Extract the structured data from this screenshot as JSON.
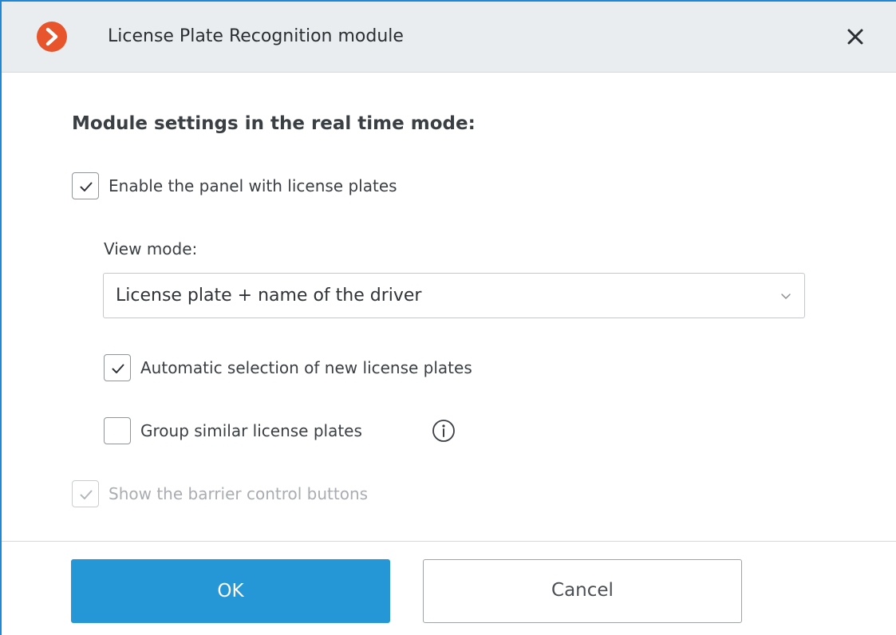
{
  "dialog": {
    "title": "License Plate Recognition module",
    "app_icon": "chevron-right-circle-icon",
    "close_icon": "close-icon",
    "accent_color": "#2596d6",
    "brand_color": "#e8542c"
  },
  "settings": {
    "heading": "Module settings in the real time mode:",
    "enable_panel": {
      "label": "Enable the panel with license plates",
      "checked": true
    },
    "view_mode": {
      "label": "View mode:",
      "selected": "License plate + name of the driver"
    },
    "auto_select": {
      "label": "Automatic selection of new license plates",
      "checked": true
    },
    "group_similar": {
      "label": "Group similar license plates",
      "checked": false,
      "info_icon": "info-icon"
    },
    "barrier_buttons": {
      "label": "Show the barrier control buttons",
      "checked": true,
      "disabled": true
    }
  },
  "footer": {
    "ok_label": "OK",
    "cancel_label": "Cancel"
  }
}
